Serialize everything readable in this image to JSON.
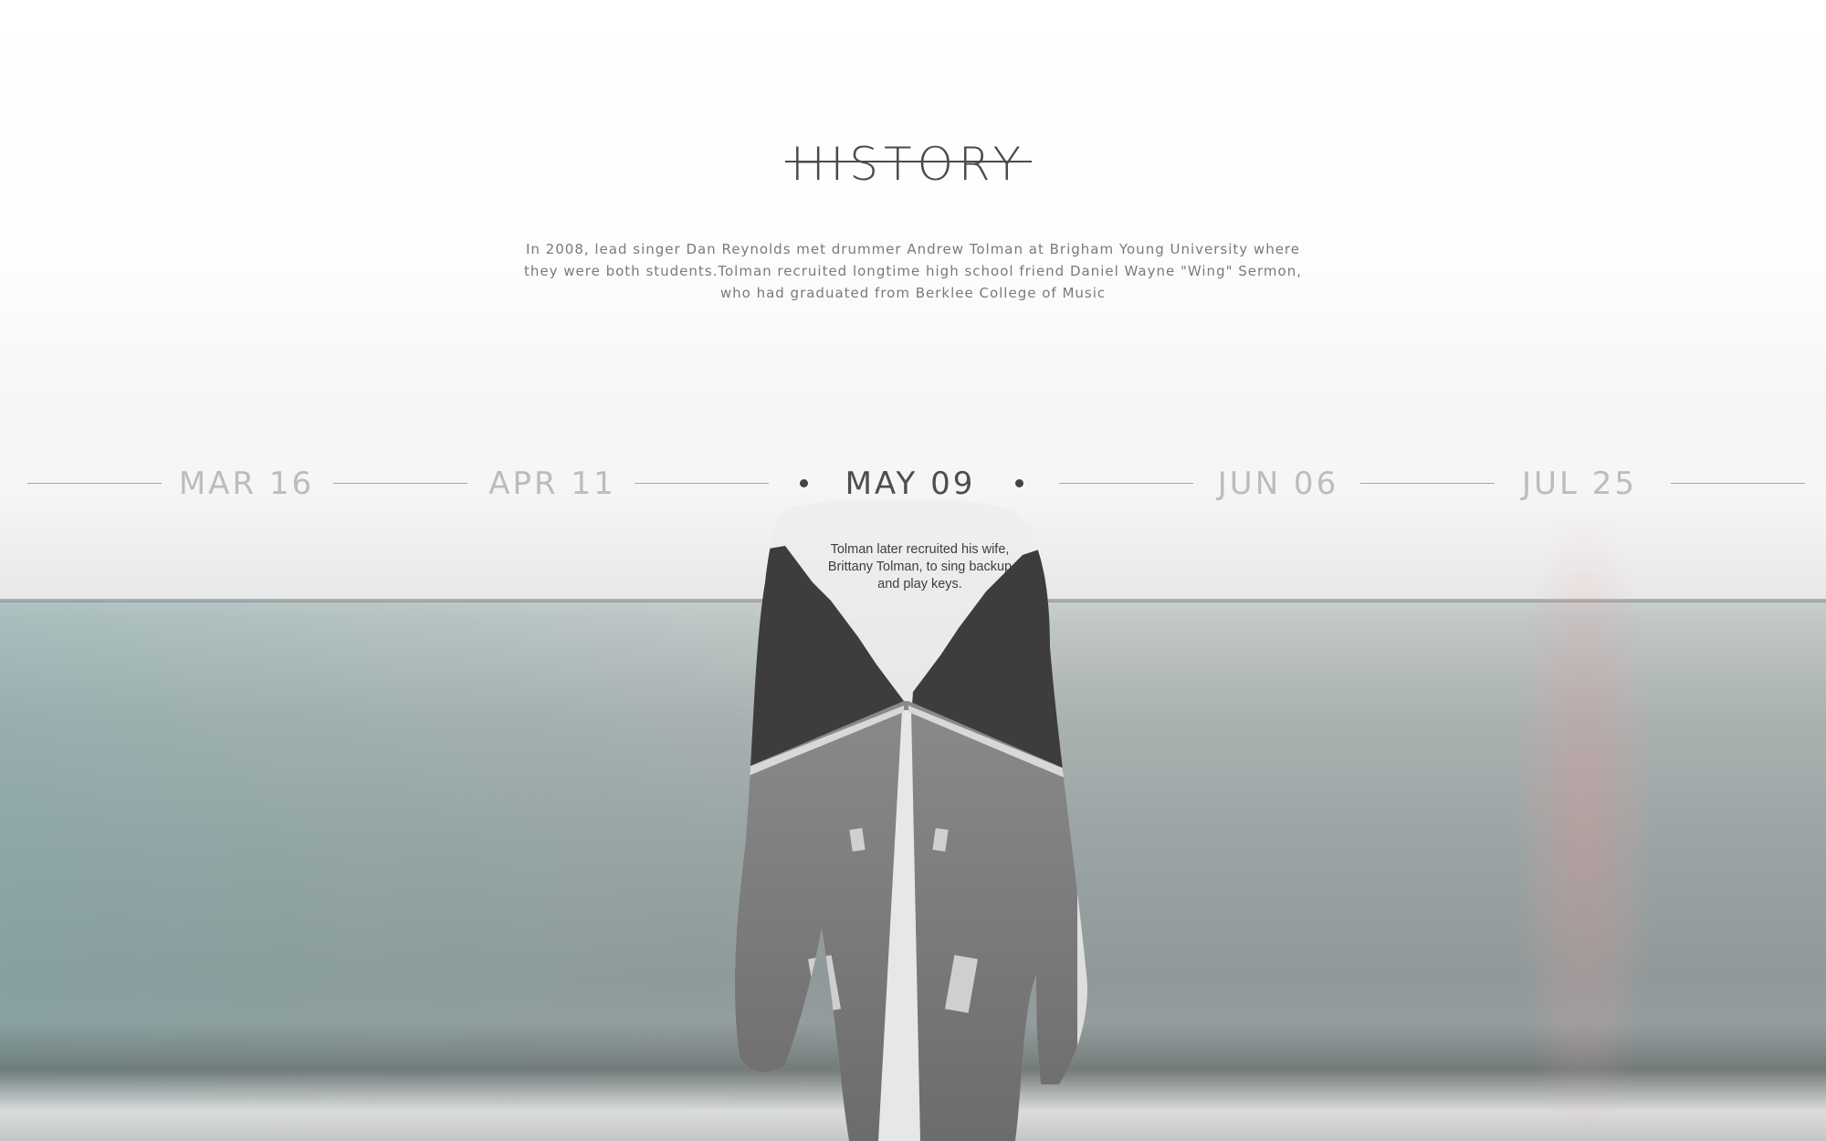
{
  "section": {
    "title": "HISTORY",
    "intro": "In 2008, lead singer Dan Reynolds met drummer Andrew Tolman at Brigham Young University where they were both students.Tolman recruited longtime high school friend Daniel Wayne \"Wing\" Sermon, who had graduated from Berklee College of Music"
  },
  "timeline": {
    "dates": [
      {
        "label": "MAR 16",
        "active": false
      },
      {
        "label": "APR 11",
        "active": false
      },
      {
        "label": "MAY 09",
        "active": true
      },
      {
        "label": "JUN 06",
        "active": false
      },
      {
        "label": "JUL 25",
        "active": false
      }
    ],
    "active_caption": "Tolman later recruited his wife, Brittany Tolman, to sing backup and play keys."
  },
  "colors": {
    "title": "#4a4a4a",
    "active_date": "#4d4d4d",
    "inactive_date": "#bcbcbc",
    "line": "#a7a7a7"
  },
  "background": {
    "icon": "sea-road-double-exposure-image"
  }
}
